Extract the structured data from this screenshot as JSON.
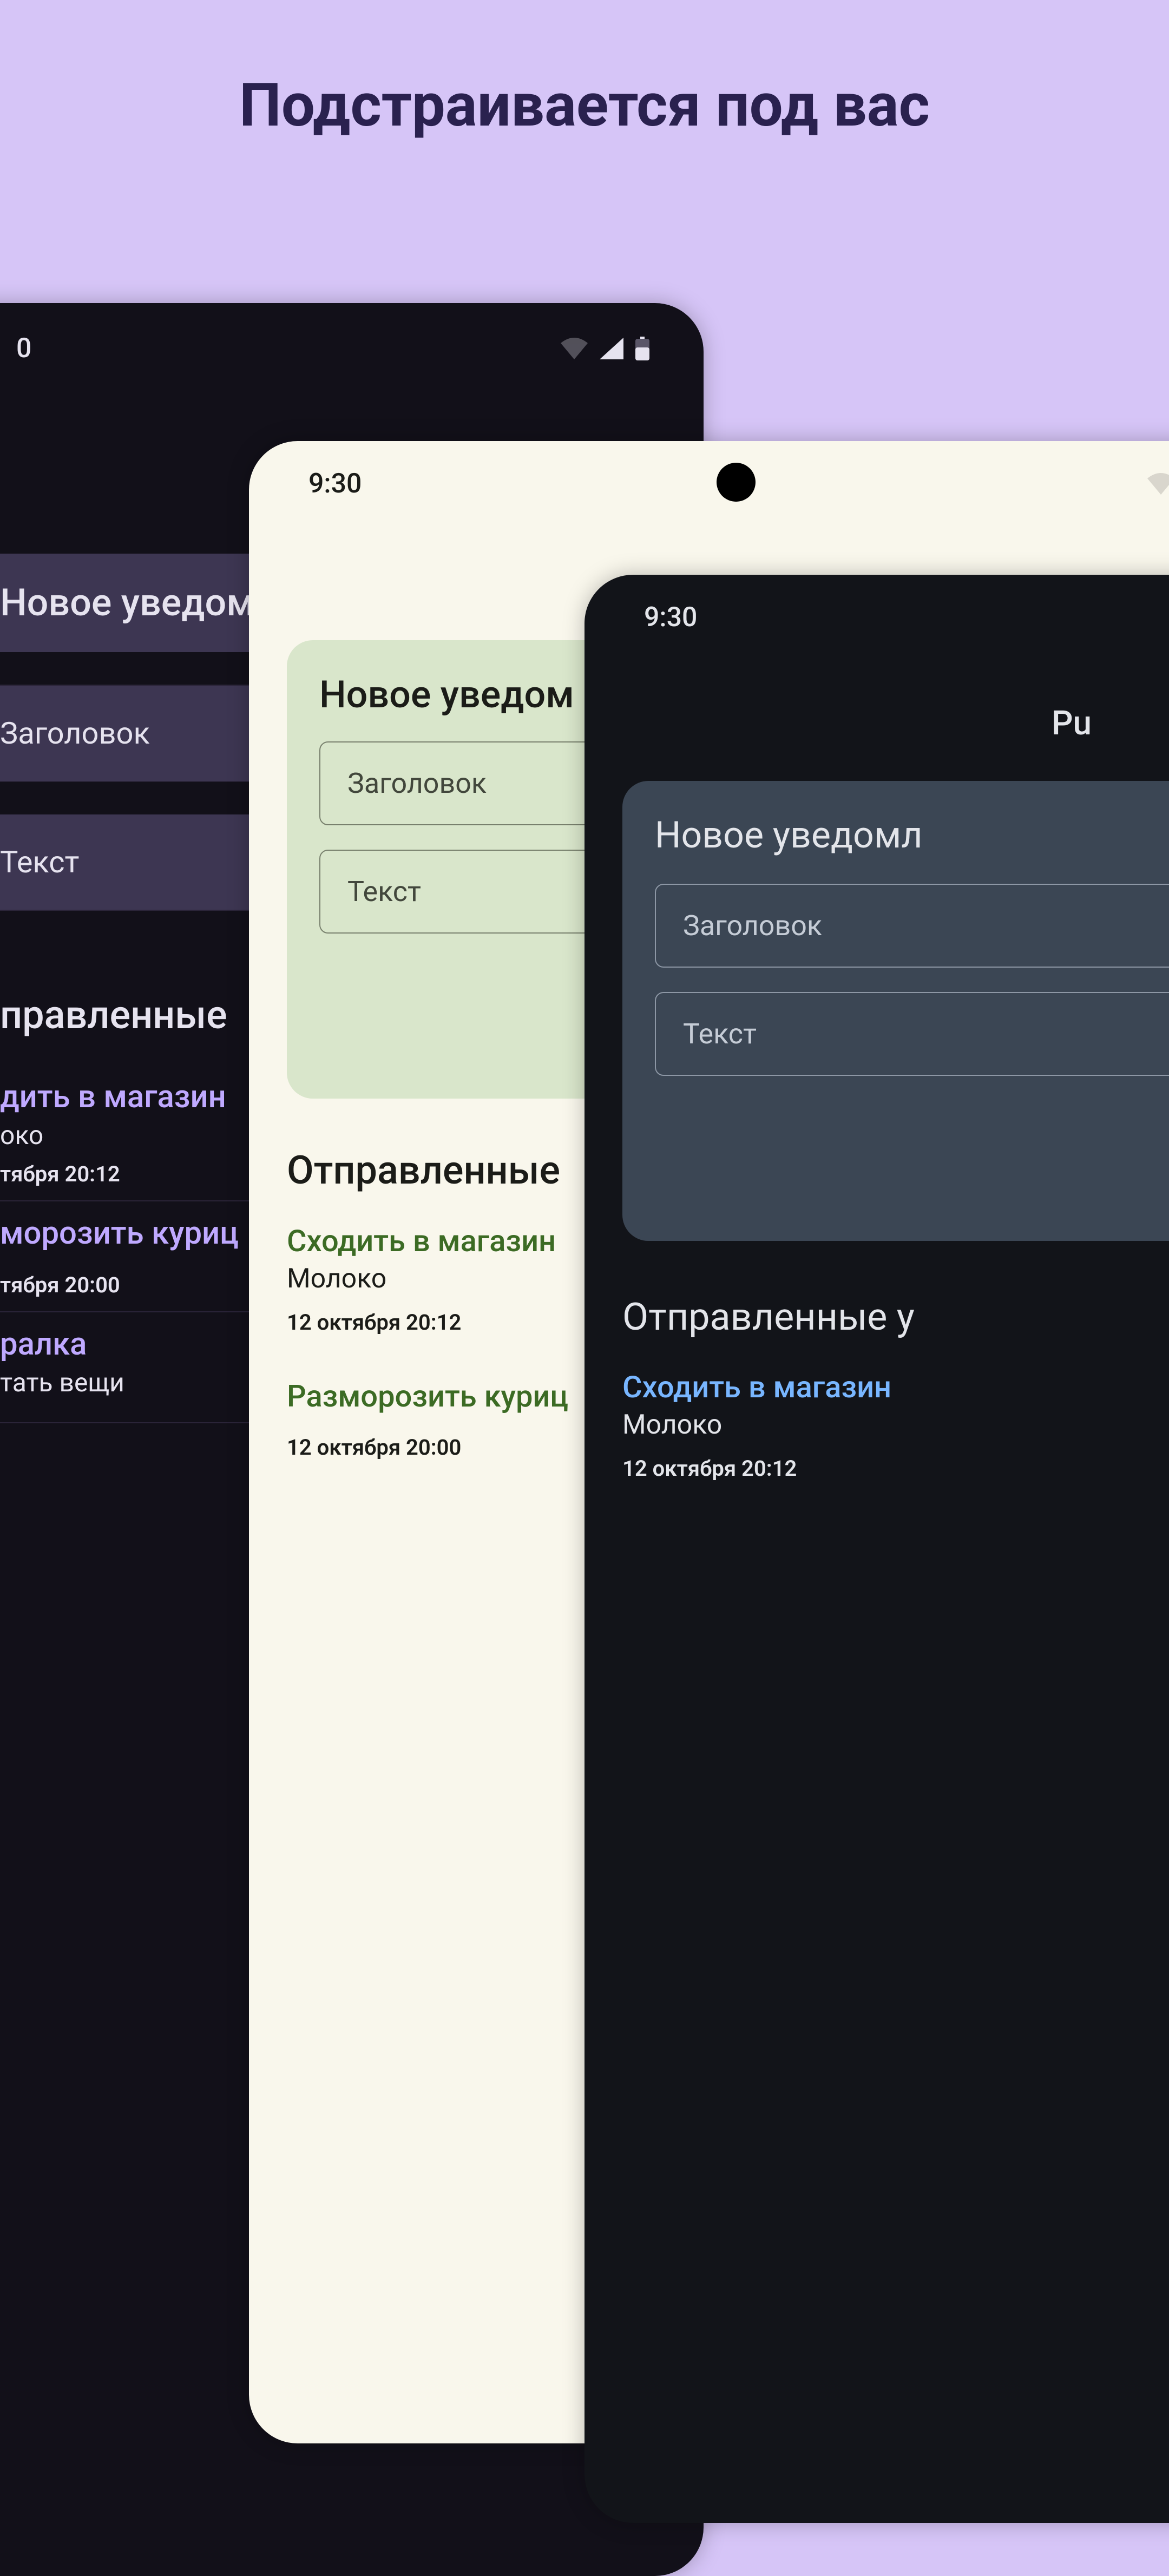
{
  "hero": {
    "title": "Подстраивается под вас"
  },
  "phone1": {
    "time_suffix": "0",
    "new_notification": {
      "title": "Новое уведом",
      "field_title": "Заголовок",
      "field_text": "Текст"
    },
    "sent_title": "правленные",
    "notifs": [
      {
        "title": "дить в магазин",
        "body": "око",
        "time": "тября 20:12"
      },
      {
        "title": "морозить куриц",
        "body": "",
        "time": "тября 20:00"
      },
      {
        "title": "ралка",
        "body": "тать вещи",
        "time": ""
      }
    ]
  },
  "phone2": {
    "time": "9:30",
    "new_notification": {
      "title": "Новое уведом",
      "field_title": "Заголовок",
      "field_text": "Текст"
    },
    "sent_title": "Отправленные",
    "notifs": [
      {
        "title": "Сходить в магазин",
        "body": "Молоко",
        "time": "12 октября 20:12"
      },
      {
        "title": "Разморозить куриц",
        "body": "",
        "time": "12 октября 20:00"
      }
    ]
  },
  "phone3": {
    "time": "9:30",
    "app_title": "Pu",
    "new_notification": {
      "title": "Новое уведомл",
      "field_title": "Заголовок",
      "field_text": "Текст"
    },
    "sent_title": "Отправленные у",
    "notifs": [
      {
        "title": "Сходить в магазин",
        "body": "Молоко",
        "time": "12 октября 20:12"
      }
    ]
  }
}
